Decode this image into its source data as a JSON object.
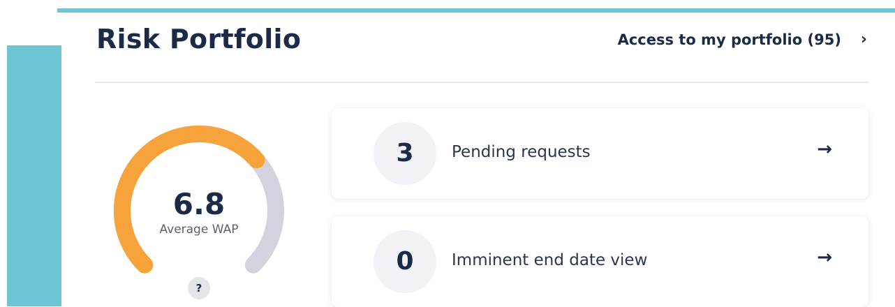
{
  "header": {
    "title": "Risk Portfolio",
    "access_link": "Access to my portfolio (95)",
    "access_chevron": "›"
  },
  "gauge": {
    "value": "6.8",
    "label": "Average WAP",
    "fill_fraction": 0.68,
    "help_label": "?",
    "fill_color": "#f6a33c",
    "track_color": "#d2d3dc"
  },
  "stats": [
    {
      "count": "3",
      "label": "Pending requests",
      "arrow": "→"
    },
    {
      "count": "0",
      "label": "Imminent end date view",
      "arrow": "→"
    }
  ],
  "colors": {
    "accent": "#6ec5d4",
    "text_dark": "#1b2a47"
  }
}
